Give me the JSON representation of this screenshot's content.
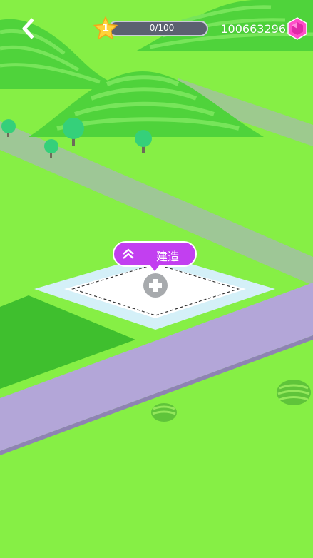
{
  "hud": {
    "back_icon": "chevron-left-icon",
    "level": "1",
    "level_icon": "star-icon",
    "progress_text": "0/100",
    "progress_fraction": 0,
    "gem_count": "100663296",
    "gem_icon": "pink-gem-icon"
  },
  "build": {
    "label": "建造",
    "icon": "double-chevron-up-icon"
  },
  "plot": {
    "add_icon": "plus-icon"
  },
  "colors": {
    "grass": "#86ef45",
    "hill": "#4dd43a",
    "road": "#b3a6d8",
    "build_button": "#c23ff0",
    "plot_border": "#d4f0f8",
    "star": "#ffd23a",
    "gem": "#ff4fc8"
  }
}
